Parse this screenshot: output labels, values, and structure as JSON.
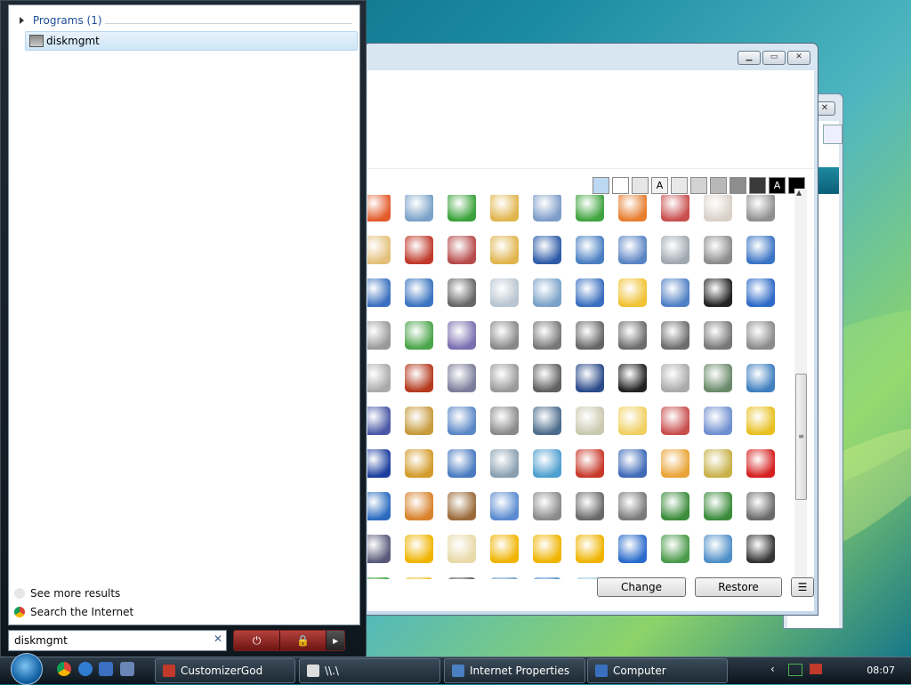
{
  "start_menu": {
    "programs_header": "Programs (1)",
    "result": "diskmgmt",
    "see_more": "See more results",
    "search_internet": "Search the Internet",
    "search_value": "diskmgmt"
  },
  "window": {
    "change_label": "Change",
    "restore_label": "Restore",
    "menu_label": "☰",
    "swatches": [
      "",
      "",
      "",
      "A",
      "",
      "",
      "",
      "",
      "",
      "A",
      ""
    ],
    "swatch_colors": [
      "#bcd8f2",
      "#ffffff",
      "#e6e6e6",
      "#f2f2f2",
      "#e8e8e8",
      "#d2d2d2",
      "#b8b8b8",
      "#8d8d8d",
      "#3a3a3a",
      "#000000",
      "#000000"
    ],
    "icon_colors": [
      "#e35a2a",
      "#7aa2c8",
      "#3aa23a",
      "#e1b54d",
      "#7d9cc8",
      "#3fa33f",
      "#e77d2e",
      "#c94e4e",
      "#d9d0c8",
      "#8f8f8f",
      "#e3c07a",
      "#c0392b",
      "#b74b4b",
      "#e1b54d",
      "#2f5ca8",
      "#4a7fc2",
      "#5a84c4",
      "#a0a8b0",
      "#8b8b8b",
      "#3a74c4",
      "#3a6fbf",
      "#3b75c0",
      "#666666",
      "#b8c4d0",
      "#7aa2c8",
      "#3a6fbf",
      "#f1c232",
      "#4f7fc4",
      "#222222",
      "#2d6ac7",
      "#999999",
      "#4aa54a",
      "#7c6fb0",
      "#888888",
      "#777777",
      "#666666",
      "#6c6c6c",
      "#6c6c6c",
      "#777777",
      "#8a8a8a",
      "#aaaaaa",
      "#b53a1e",
      "#7d7d9b",
      "#9a9a9a",
      "#606060",
      "#2a4b8a",
      "#222222",
      "#aaaaaa",
      "#6a8a6a",
      "#3f7fc0",
      "#4a58a6",
      "#c79a3c",
      "#5a88c7",
      "#8a8a8a",
      "#4c6c8c",
      "#c9c9b0",
      "#f0d060",
      "#c94e4e",
      "#6f8fd0",
      "#e8c020",
      "#1c3f9e",
      "#d39b2b",
      "#4a7bc0",
      "#8aa0b0",
      "#4f9fd0",
      "#c8392b",
      "#3f6ab8",
      "#e9a437",
      "#c8b14a",
      "#d62020",
      "#2a6bbf",
      "#d9822b",
      "#9a6b3a",
      "#5a8bd0",
      "#8a8a8a",
      "#6a6a6a",
      "#7a7a7a",
      "#3c8c3c",
      "#3c8c3c",
      "#6a6a6a",
      "#5a5a7a",
      "#f0b400",
      "#e8d9a8",
      "#f0b400",
      "#f0b400",
      "#f0b400",
      "#2a6bcc",
      "#4a9a4a",
      "#4f8fc8",
      "#333333",
      "#3aa23a",
      "#f0c020",
      "#555555",
      "#6aa0d0",
      "#4f8fc8",
      "#9cc7e0",
      "#3c9a3c",
      "#dfe8f0",
      "#3a5f8c",
      "#a0b8d0"
    ]
  },
  "taskbar": {
    "tasks": [
      {
        "label": "CustomizerGod",
        "color": "#c0392b"
      },
      {
        "label": "\\\\.\\",
        "color": "#dddddd"
      },
      {
        "label": "Internet Properties",
        "color": "#4a7fc2"
      },
      {
        "label": "Computer",
        "color": "#3a6fbf"
      }
    ],
    "clock": "08:07"
  }
}
